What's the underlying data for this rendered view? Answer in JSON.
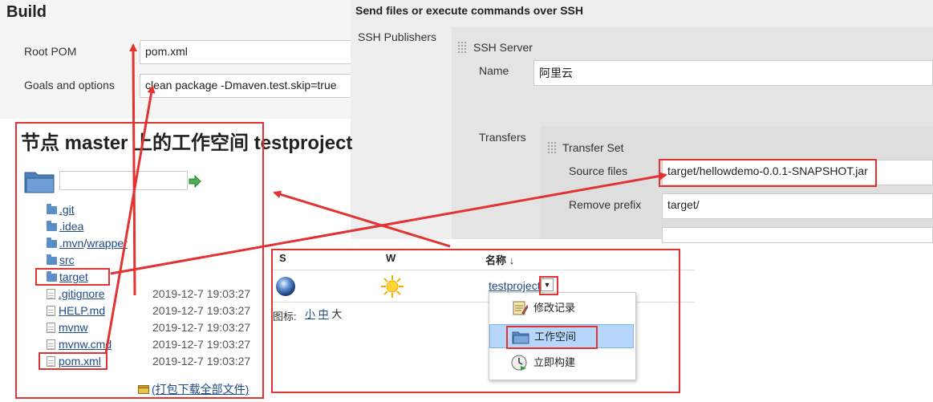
{
  "build": {
    "title": "Build",
    "root_pom_label": "Root POM",
    "root_pom_value": "pom.xml",
    "goals_label": "Goals and options",
    "goals_value": "clean package -Dmaven.test.skip=true"
  },
  "ssh": {
    "title": "Send files or execute commands over SSH",
    "publishers_label": "SSH Publishers",
    "server_label": "SSH Server",
    "name_label": "Name",
    "name_value": "阿里云",
    "transfers_label": "Transfers",
    "transfer_set_label": "Transfer Set",
    "source_files_label": "Source files",
    "source_files_value": "target/hellowdemo-0.0.1-SNAPSHOT.jar",
    "remove_prefix_label": "Remove prefix",
    "remove_prefix_value": "target/"
  },
  "workspace": {
    "title": "节点 master 上的工作空间 testproject",
    "path_value": "",
    "folders": [
      ".git",
      ".idea",
      "src",
      "target"
    ],
    "mvn_folder": ".mvn",
    "mvn_sub": "wrapper",
    "files": [
      {
        "name": ".gitignore",
        "date": "2019-12-7 19:03:27"
      },
      {
        "name": "HELP.md",
        "date": "2019-12-7 19:03:27"
      },
      {
        "name": "mvnw",
        "date": "2019-12-7 19:03:27"
      },
      {
        "name": "mvnw.cmd",
        "date": "2019-12-7 19:03:27"
      },
      {
        "name": "pom.xml",
        "date": "2019-12-7 19:03:27"
      }
    ],
    "download_all": "(打包下载全部文件)"
  },
  "joblist": {
    "col_s": "S",
    "col_w": "W",
    "col_name": "名称 ↓",
    "job_name": "testproject",
    "icon_label": "图标:",
    "size_small": "小",
    "size_medium": "中",
    "size_large": "大",
    "menu": [
      "修改记录",
      "工作空间",
      "立即构建"
    ]
  },
  "colors": {
    "highlight": "#e23232",
    "link": "#204a87",
    "menu_selected": "#b7d6fb"
  }
}
